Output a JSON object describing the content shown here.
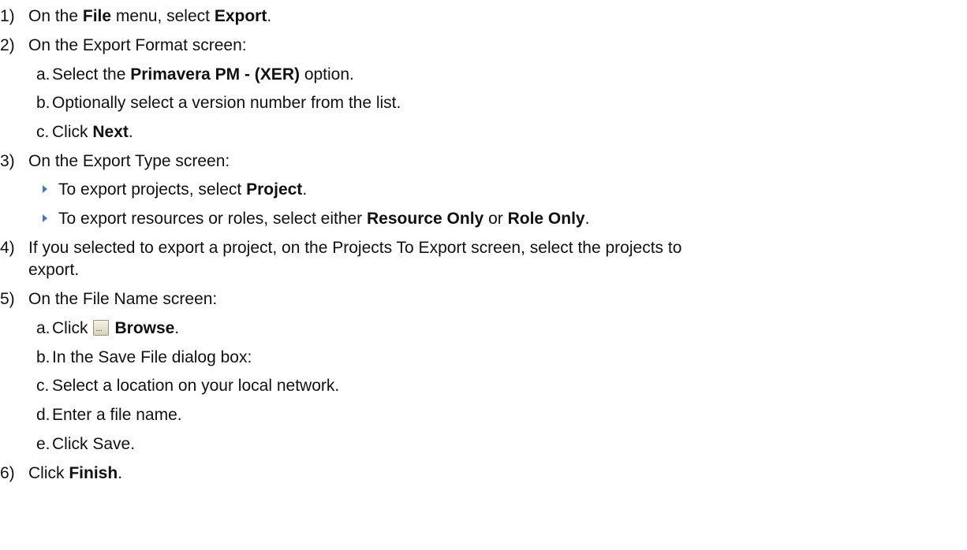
{
  "steps": [
    {
      "number": "1)",
      "pre": "On the ",
      "b1": "File",
      "mid": " menu, select ",
      "b2": "Export",
      "post": "."
    },
    {
      "number": "2)",
      "text": "On the Export Format screen:",
      "sub": [
        {
          "letter": "a.",
          "pre": "Select the ",
          "bold": "Primavera PM - (XER)",
          "post": " option."
        },
        {
          "letter": "b.",
          "text": "Optionally select a version number from the list."
        },
        {
          "letter": "c.",
          "pre": "Click ",
          "bold": "Next",
          "post": "."
        }
      ]
    },
    {
      "number": "3)",
      "text": "On the Export Type screen:",
      "bullets": [
        {
          "icon": "triangle-bullet-icon",
          "pre": "To export projects, select ",
          "bold": "Project",
          "post": "."
        },
        {
          "icon": "triangle-bullet-icon",
          "pre": "To export resources or roles, select either ",
          "bold1": "Resource Only",
          "mid": " or ",
          "bold2": "Role Only",
          "post": "."
        }
      ]
    },
    {
      "number": "4)",
      "line1": "If you selected to export a project, on the Projects To Export screen, select the projects to",
      "line2": "export."
    },
    {
      "number": "5)",
      "text": "On the File Name screen:",
      "sub": [
        {
          "letter": "a.",
          "pre": "Click",
          "icon": "browse-icon",
          "icon_label": "...",
          "bold": "Browse",
          "post": "."
        },
        {
          "letter": "b.",
          "text": "In the Save File dialog box:"
        },
        {
          "letter": "c.",
          "text": "Select a location on your local network."
        },
        {
          "letter": "d.",
          "text": "Enter a file name."
        },
        {
          "letter": "e.",
          "text": "Click Save."
        }
      ]
    },
    {
      "number": "6)",
      "pre": "Click ",
      "bold": "Finish",
      "post": "."
    }
  ],
  "colors": {
    "text": "#111111",
    "bullet": "#4a79b8"
  }
}
